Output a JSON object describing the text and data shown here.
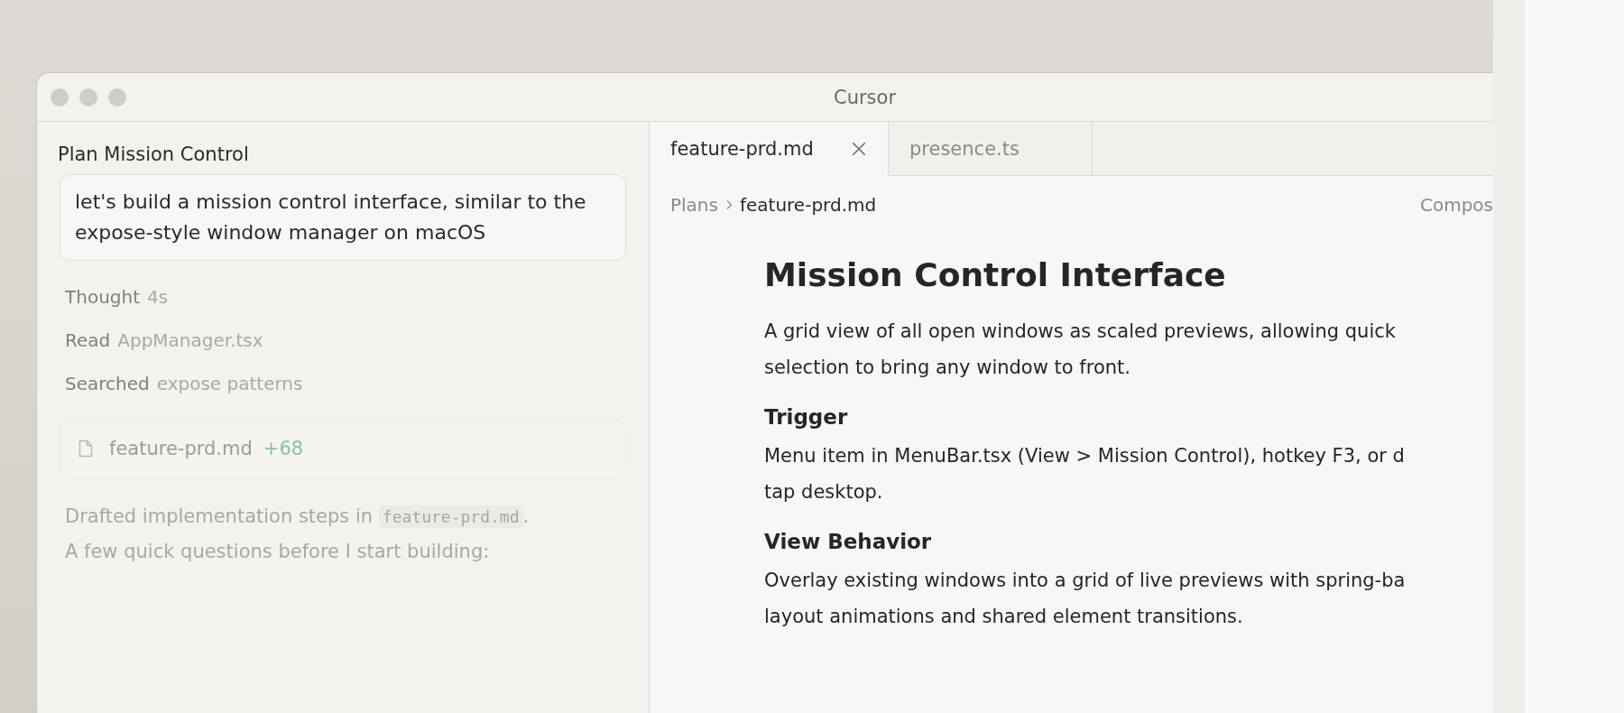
{
  "window": {
    "title": "Cursor"
  },
  "chat": {
    "title": "Plan Mission Control",
    "prompt": "let's build a mission control interface, similar to the expose-style window manager on macOS",
    "activity": [
      {
        "action": "Thought",
        "detail": "4s"
      },
      {
        "action": "Read",
        "detail": "AppManager.tsx"
      },
      {
        "action": "Searched",
        "detail": "expose patterns"
      }
    ],
    "file_card": {
      "name": "feature-prd.md",
      "additions": "+68"
    },
    "message": [
      [
        {
          "kind": "text",
          "text": "Drafted implementation steps in "
        },
        {
          "kind": "code",
          "text": "feature-prd.md"
        },
        {
          "kind": "text",
          "text": "."
        }
      ],
      [
        {
          "kind": "text",
          "text": "A few quick questions before I start building:"
        }
      ]
    ]
  },
  "editor": {
    "tabs": [
      {
        "label": "feature-prd.md",
        "selected": true
      },
      {
        "label": "presence.ts",
        "selected": false
      }
    ],
    "breadcrumb": [
      "Plans",
      "feature-prd.md"
    ],
    "mode": "Compos",
    "document": [
      {
        "kind": "h1",
        "lines": [
          "Mission Control Interface"
        ]
      },
      {
        "kind": "p",
        "lines": [
          "A grid view of all open windows as scaled previews, allowing quick",
          "selection to bring any window to front."
        ]
      },
      {
        "kind": "h2",
        "lines": [
          "Trigger"
        ]
      },
      {
        "kind": "p",
        "lines": [
          "Menu item in MenuBar.tsx (View > Mission Control), hotkey F3, or d",
          "tap desktop."
        ]
      },
      {
        "kind": "h2",
        "lines": [
          "View Behavior"
        ]
      },
      {
        "kind": "p",
        "lines": [
          "Overlay existing windows into a grid of live previews with spring-ba",
          "layout animations and shared element transitions."
        ]
      }
    ]
  }
}
